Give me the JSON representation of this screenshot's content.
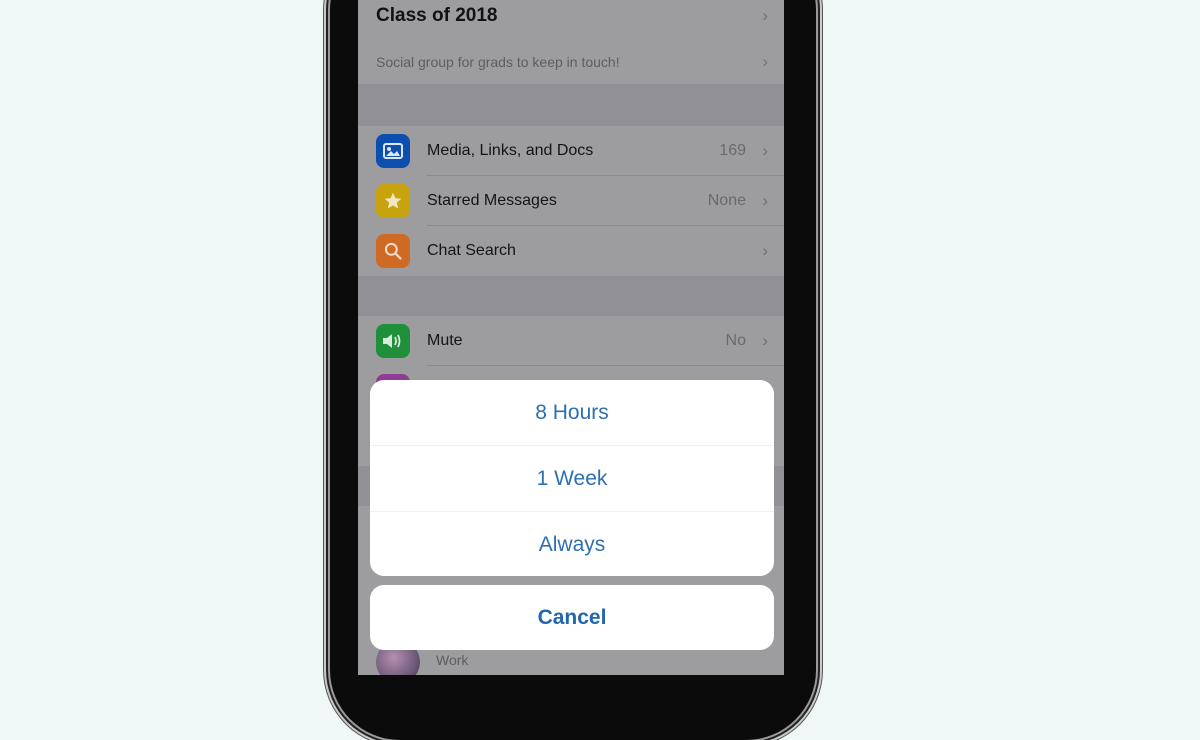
{
  "group": {
    "name": "Class of 2018",
    "description": "Social group for grads to keep in touch!"
  },
  "menu": {
    "media": {
      "label": "Media, Links, and Docs",
      "value": "169",
      "icon": "photo-icon",
      "color": "#0d4fae"
    },
    "starred": {
      "label": "Starred Messages",
      "value": "None",
      "icon": "star-icon",
      "color": "#c9a20f"
    },
    "search": {
      "label": "Chat Search",
      "value": "",
      "icon": "search-icon",
      "color": "#cf6a24"
    },
    "mute": {
      "label": "Mute",
      "value": "No",
      "icon": "speaker-icon",
      "color": "#1f8f3a"
    },
    "next_icon_color": "#8e3d93"
  },
  "participant": {
    "subtitle": "Work"
  },
  "action_sheet": {
    "options": [
      {
        "label": "8 Hours"
      },
      {
        "label": "1 Week"
      },
      {
        "label": "Always"
      }
    ],
    "cancel_label": "Cancel",
    "text_color": "#2d6fb3"
  },
  "chevron": "›"
}
